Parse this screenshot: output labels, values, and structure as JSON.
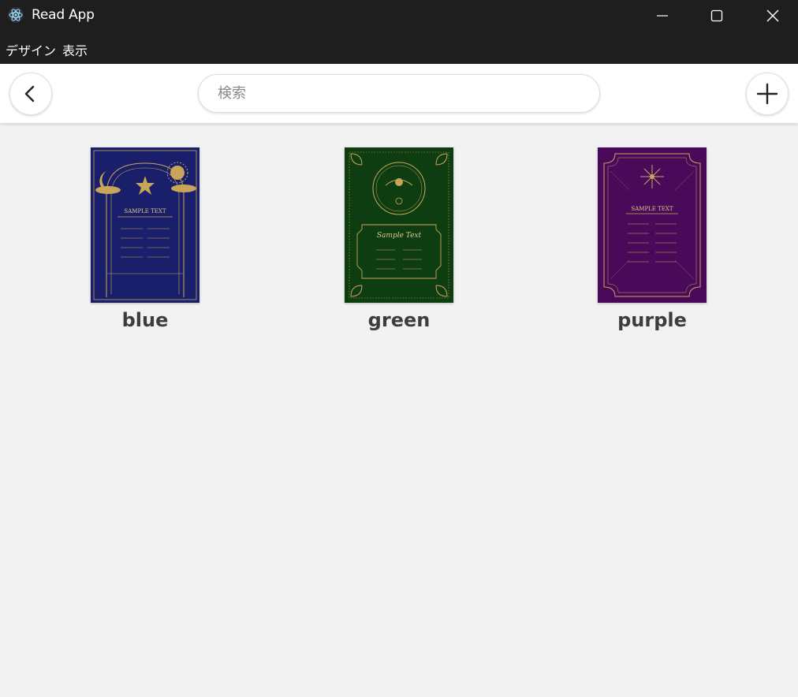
{
  "window": {
    "title": "Read App",
    "icon": "electron-atom-icon"
  },
  "menu": {
    "items": [
      {
        "label": "デザイン"
      },
      {
        "label": "表示"
      }
    ]
  },
  "toolbar": {
    "back_icon": "chevron-left-icon",
    "add_icon": "plus-icon",
    "search": {
      "placeholder": "検索",
      "value": ""
    }
  },
  "books": [
    {
      "label": "blue",
      "cover_color": "#1a1f6b",
      "cover_text": "SAMPLE TEXT"
    },
    {
      "label": "green",
      "cover_color": "#0f3d12",
      "cover_text": "Sample Text"
    },
    {
      "label": "purple",
      "cover_color": "#4a0a5a",
      "cover_text": "SAMPLE TEXT"
    }
  ],
  "colors": {
    "titlebar": "#1f1e1e",
    "background": "#f2f2f2",
    "gold": "#c9a55a"
  }
}
